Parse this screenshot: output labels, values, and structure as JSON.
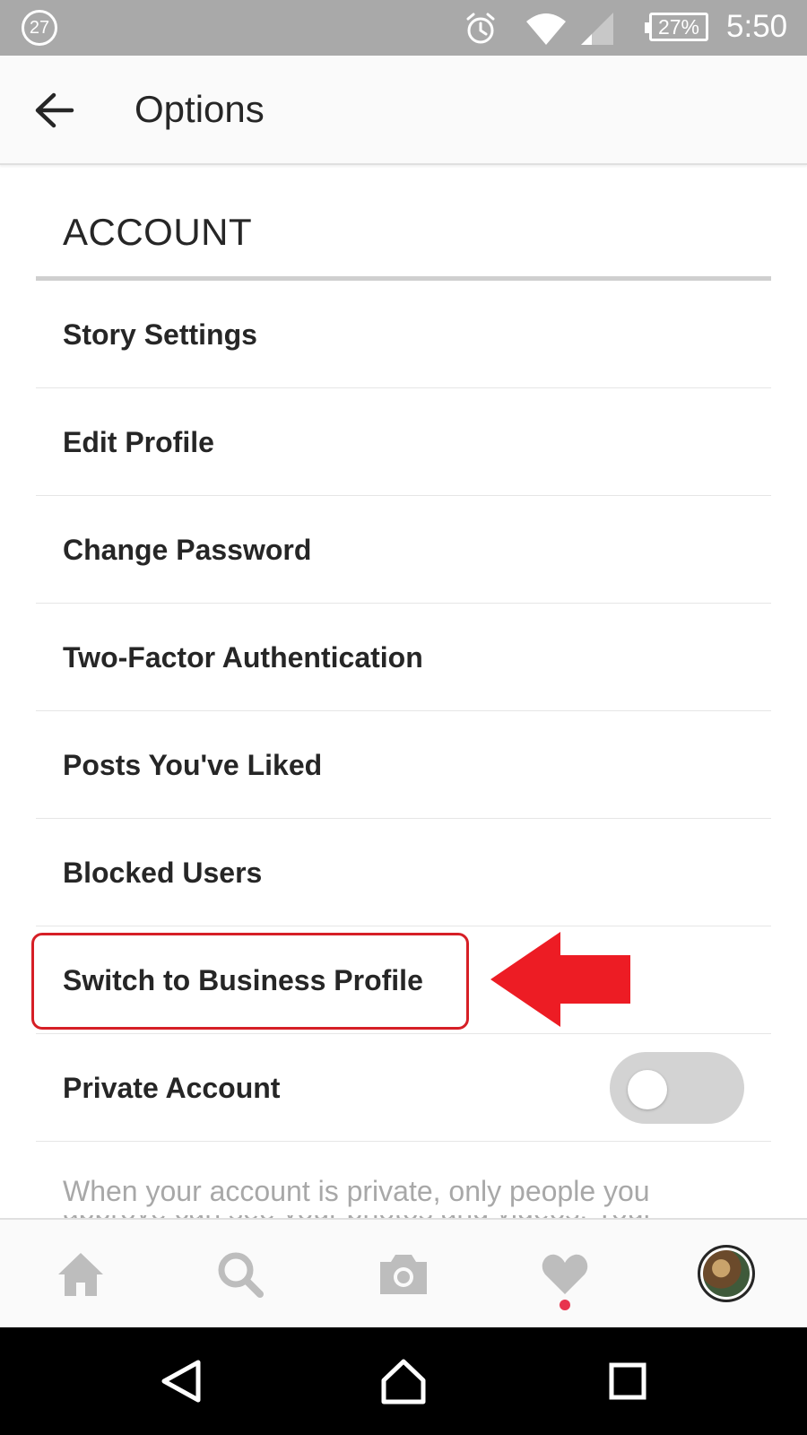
{
  "status_bar": {
    "notification_badge": "27",
    "battery_percent": "27%",
    "time": "5:50"
  },
  "header": {
    "title": "Options"
  },
  "section": {
    "heading": "ACCOUNT"
  },
  "menu": {
    "items": [
      {
        "label": "Story Settings"
      },
      {
        "label": "Edit Profile"
      },
      {
        "label": "Change Password"
      },
      {
        "label": "Two-Factor Authentication"
      },
      {
        "label": "Posts You've Liked"
      },
      {
        "label": "Blocked Users"
      },
      {
        "label": "Switch to Business Profile"
      },
      {
        "label": "Private Account"
      }
    ]
  },
  "private_account": {
    "toggle_on": false,
    "note_line_1": "When your account is private, only people you",
    "note_line_2_partial": "approve can see your photos and videos. Your"
  },
  "annotations": {
    "highlight_color": "#d61f26",
    "arrow_color": "#ed1c24"
  },
  "bottom_nav": {
    "items": [
      "home-icon",
      "search-icon",
      "camera-icon",
      "heart-icon",
      "profile-avatar"
    ],
    "activity_dot_color": "#e8344e"
  },
  "system_nav": {
    "items": [
      "back-triangle-icon",
      "home-outline-icon",
      "recents-square-icon"
    ]
  }
}
